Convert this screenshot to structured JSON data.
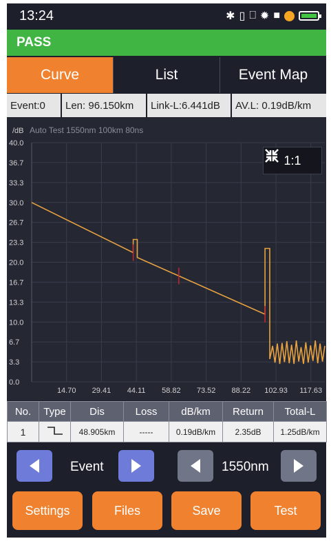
{
  "status": {
    "time": "13:24"
  },
  "result": {
    "label": "PASS"
  },
  "tabs": [
    {
      "label": "Curve",
      "active": true
    },
    {
      "label": "List"
    },
    {
      "label": "Event Map"
    }
  ],
  "info": {
    "event": "Event:0",
    "len": "Len: 96.150km",
    "link_l": "Link-L:6.441dB",
    "av_l": "AV.L: 0.19dB/km"
  },
  "chart_header": {
    "unit": "/dB",
    "caption": "Auto Test  1550nm  100km  80ns"
  },
  "zoom": {
    "label": "1:1"
  },
  "chart_data": {
    "type": "line",
    "ylabel": "/dB",
    "ylim": [
      0,
      40
    ],
    "y_ticks": [
      "40.0",
      "36.7",
      "33.3",
      "30.0",
      "26.7",
      "23.3",
      "20.0",
      "16.7",
      "13.3",
      "10.0",
      "6.7",
      "3.3",
      "0.0"
    ],
    "x_ticks": [
      "14.70",
      "29.41",
      "44.11",
      "58.82",
      "73.52",
      "88.22",
      "102.93",
      "117.63"
    ],
    "xlim": [
      0,
      123.5
    ],
    "grid": true,
    "series": [
      {
        "color": "#e8a340",
        "x": [
          0,
          42.8,
          42.8,
          44.5,
          44.5,
          98.3,
          98.3,
          100.3,
          100.3,
          101.5,
          102.5,
          103.5,
          104.5,
          105.5,
          106.5,
          107.5,
          108.5,
          109.5,
          110.5,
          111.5,
          112.5,
          113.5,
          114.5,
          115.5,
          116.5,
          117.5,
          118.5,
          119.5,
          120.5,
          121.5,
          122.5,
          123.5
        ],
        "y": [
          30.0,
          21.6,
          23.8,
          23.8,
          20.8,
          11.3,
          22.3,
          22.3,
          3.8,
          6.0,
          3.2,
          6.4,
          3.0,
          6.5,
          3.3,
          6.8,
          3.1,
          6.2,
          3.0,
          6.9,
          3.4,
          5.8,
          3.0,
          6.6,
          3.2,
          6.1,
          3.5,
          6.9,
          3.1,
          6.4,
          3.4,
          6.0
        ]
      }
    ]
  },
  "event_table": {
    "headers": [
      "No.",
      "Type",
      "Dis",
      "Loss",
      "dB/km",
      "Return",
      "Total-L"
    ],
    "rows": [
      {
        "no": "1",
        "type": "step-icon",
        "dis": "48.905km",
        "loss": "-----",
        "dbkm": "0.19dB/km",
        "ret": "2.35dB",
        "total": "1.25dB/km"
      }
    ]
  },
  "nav": {
    "event_label": "Event",
    "wavelength_label": "1550nm"
  },
  "actions": {
    "settings": "Settings",
    "files": "Files",
    "save": "Save",
    "test": "Test"
  },
  "colors": {
    "accent": "#f0822f",
    "pass": "#41b544",
    "trace": "#e8a340",
    "marker": "#c8272c"
  }
}
